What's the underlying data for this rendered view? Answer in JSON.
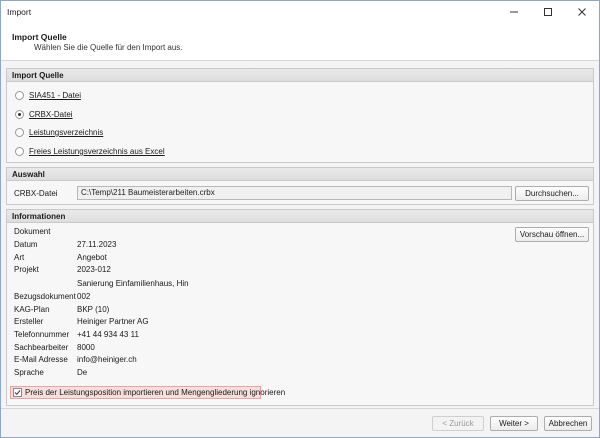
{
  "window": {
    "title": "Import"
  },
  "header": {
    "title": "Import Quelle",
    "subtitle": "Wählen Sie die Quelle für den Import aus."
  },
  "import_source": {
    "heading": "Import Quelle",
    "options": [
      {
        "label": "SIA451 - Datei",
        "selected": false
      },
      {
        "label": "CRBX-Datei",
        "selected": true
      },
      {
        "label": "Leistungsverzeichnis",
        "selected": false
      },
      {
        "label": "Freies Leistungsverzeichnis aus Excel",
        "selected": false
      }
    ]
  },
  "selection": {
    "heading": "Auswahl",
    "field_label": "CRBX-Datei",
    "path_value": "C:\\Temp\\211 Baumeisterarbeiten.crbx",
    "browse_label": "Durchsuchen..."
  },
  "info": {
    "heading": "Informationen",
    "preview_label": "Vorschau öffnen...",
    "rows": [
      {
        "key": "Dokument",
        "value": ""
      },
      {
        "key": "Datum",
        "value": "27.11.2023"
      },
      {
        "key": "Art",
        "value": "Angebot"
      },
      {
        "key": "Projekt",
        "value": "2023-012"
      },
      {
        "key": "",
        "value": "Sanierung Einfamilienhaus, Hin"
      },
      {
        "key": "Bezugsdokument",
        "value": "002"
      },
      {
        "key": "KAG-Plan",
        "value": "BKP (10)"
      },
      {
        "key": "Ersteller",
        "value": "Heiniger   Partner AG"
      },
      {
        "key": "Telefonnummer",
        "value": "+41 44 934 43 11"
      },
      {
        "key": "Sachbearbeiter",
        "value": "8000"
      },
      {
        "key": "E-Mail Adresse",
        "value": "info@heiniger.ch"
      },
      {
        "key": "Sprache",
        "value": "De"
      }
    ]
  },
  "option": {
    "checked": true,
    "label": "Preis der Leistungsposition importieren und Mengengliederung ignorieren"
  },
  "footer": {
    "back_label": "< Zurück",
    "next_label": "Weiter >",
    "cancel_label": "Abbrechen"
  }
}
